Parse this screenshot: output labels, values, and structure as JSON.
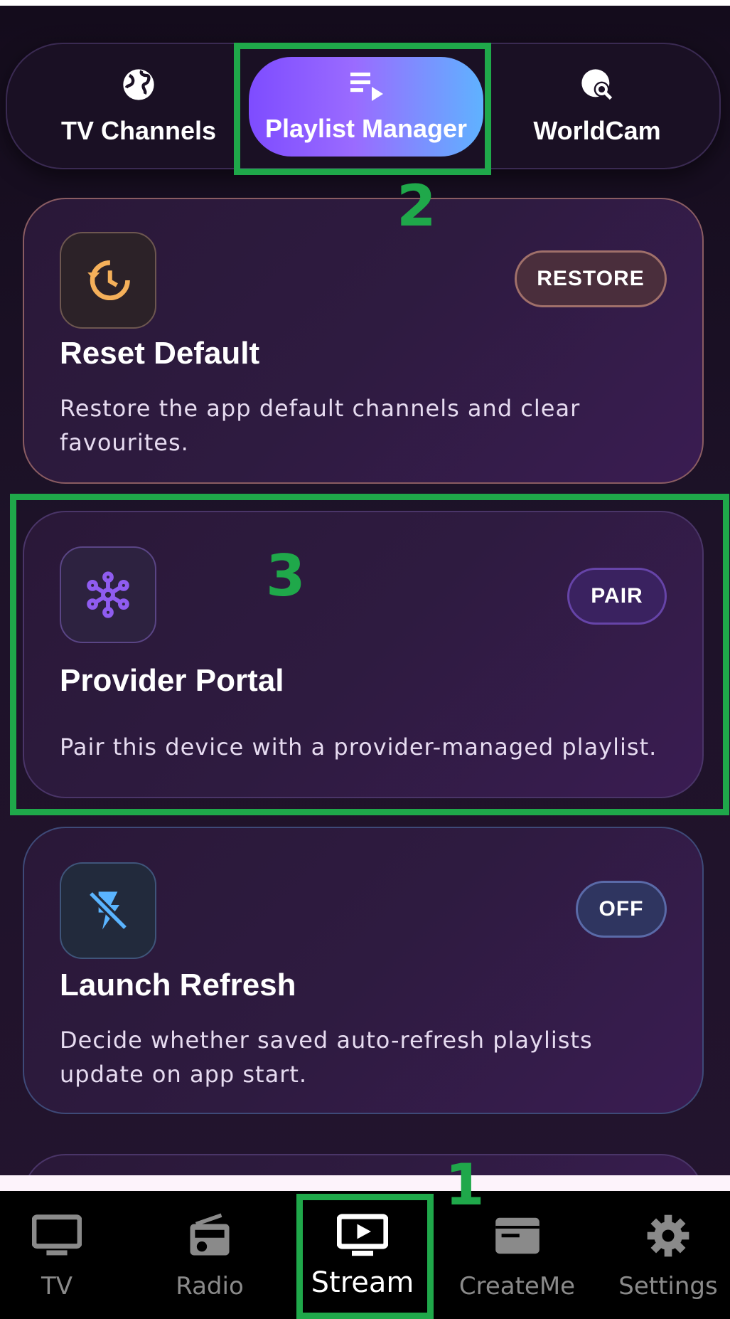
{
  "tabs": [
    {
      "label": "TV Channels",
      "icon": "globe-icon"
    },
    {
      "label": "Playlist Manager",
      "icon": "playlist-play-icon",
      "selected": true
    },
    {
      "label": "WorldCam",
      "icon": "globe-search-icon"
    }
  ],
  "cards": {
    "reset": {
      "title": "Reset Default",
      "description": "Restore the app default channels and clear favourites.",
      "action": "RESTORE",
      "icon": "restore-history-icon"
    },
    "provider": {
      "title": "Provider Portal",
      "description": "Pair this device with a provider-managed playlist.",
      "action": "PAIR",
      "icon": "hub-network-icon"
    },
    "launch": {
      "title": "Launch Refresh",
      "description": "Decide whether saved auto-refresh playlists update on app start.",
      "action": "OFF",
      "icon": "flash-off-icon"
    }
  },
  "annotations": {
    "one": "1",
    "two": "2",
    "three": "3"
  },
  "bottom_nav": [
    {
      "label": "TV",
      "icon": "tv-icon"
    },
    {
      "label": "Radio",
      "icon": "radio-icon"
    },
    {
      "label": "Stream",
      "icon": "stream-play-icon",
      "selected": true
    },
    {
      "label": "CreateMe",
      "icon": "createme-icon"
    },
    {
      "label": "Settings",
      "icon": "gear-icon"
    }
  ],
  "colors": {
    "annotation": "#1fa84a",
    "accent_start": "#7e4cff",
    "accent_end": "#5fb2ff",
    "orange_icon": "#f5b05a",
    "purple_icon": "#8f5cf0",
    "blue_icon": "#5ab4ff"
  }
}
